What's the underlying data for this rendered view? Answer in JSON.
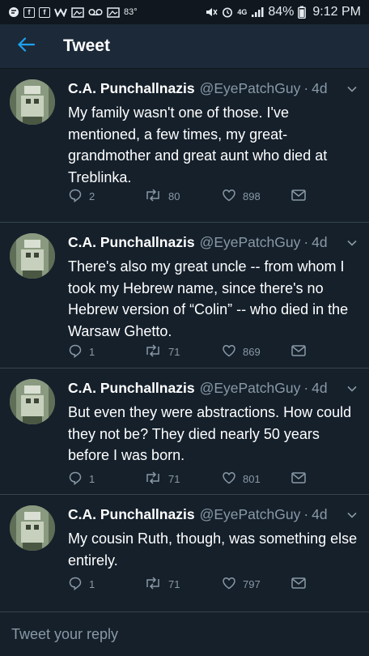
{
  "status_bar": {
    "temperature": "83°",
    "battery_percent": "84%",
    "time": "9:12 PM",
    "network": "4G",
    "left_icons": [
      "notification-icon",
      "facebook-icon",
      "facebook-icon",
      "wattpad-icon",
      "gallery-icon",
      "voicemail-icon",
      "gallery-icon"
    ],
    "right_icons": [
      "mute-icon",
      "alarm-icon",
      "signal-icon",
      "battery-icon"
    ]
  },
  "header": {
    "title": "Tweet",
    "back_icon": "back-arrow-icon"
  },
  "tweets": [
    {
      "name": "C.A. Punchallnazis",
      "handle": "@EyePatchGuy",
      "sep": "·",
      "time": "4d",
      "text": "My family wasn't one of those. I've mentioned, a few times, my great-grandmother and great aunt who died at Treblinka.",
      "replies": "2",
      "retweets": "80",
      "likes": "898"
    },
    {
      "name": "C.A. Punchallnazis",
      "handle": "@EyePatchGuy",
      "sep": "·",
      "time": "4d",
      "text": "There's also my great uncle -- from whom I took my Hebrew name, since there's no Hebrew version of “Colin” -- who died in the Warsaw Ghetto.",
      "replies": "1",
      "retweets": "71",
      "likes": "869"
    },
    {
      "name": "C.A. Punchallnazis",
      "handle": "@EyePatchGuy",
      "sep": "·",
      "time": "4d",
      "text": "But even they were abstractions. How could they not be? They died nearly 50 years before I was born.",
      "replies": "1",
      "retweets": "71",
      "likes": "801"
    },
    {
      "name": "C.A. Punchallnazis",
      "handle": "@EyePatchGuy",
      "sep": "·",
      "time": "4d",
      "text": "My cousin Ruth, though, was something else entirely.",
      "replies": "1",
      "retweets": "71",
      "likes": "797"
    }
  ],
  "reply_box": {
    "placeholder": "Tweet your reply"
  },
  "colors": {
    "background": "#15202b",
    "header": "#1c2938",
    "accent": "#1da1f2",
    "secondary_text": "#8899a6",
    "divider": "#38444d"
  }
}
